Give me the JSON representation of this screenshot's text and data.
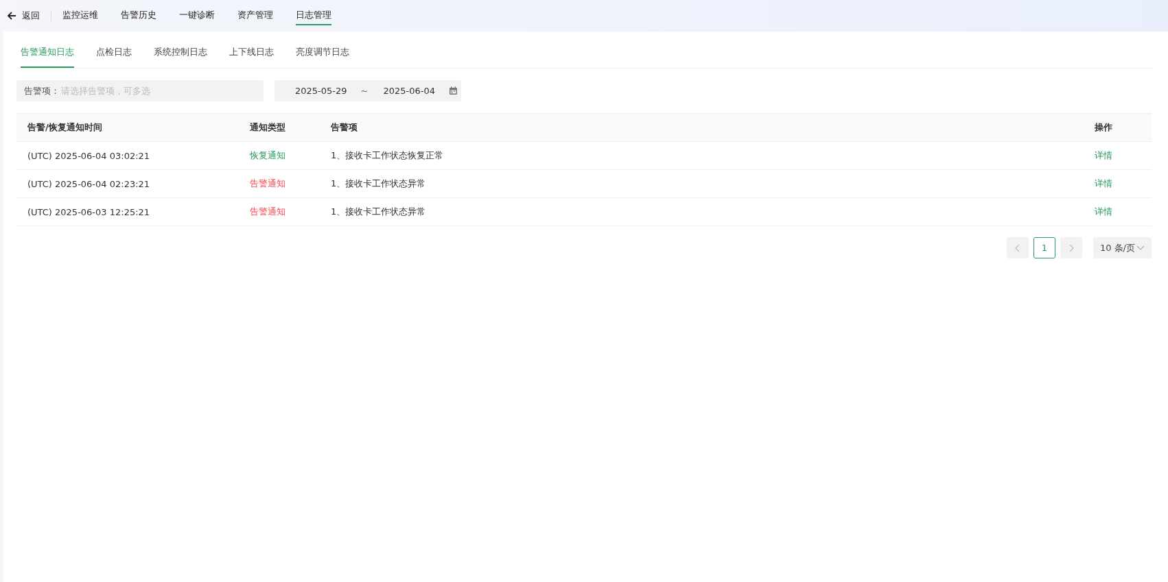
{
  "top_nav": {
    "back": "返回",
    "items": [
      {
        "label": "监控运维",
        "selected": false
      },
      {
        "label": "告警历史",
        "selected": false
      },
      {
        "label": "一键诊断",
        "selected": false
      },
      {
        "label": "资产管理",
        "selected": false
      },
      {
        "label": "日志管理",
        "selected": true
      }
    ]
  },
  "tabs": [
    {
      "label": "告警通知日志",
      "selected": true
    },
    {
      "label": "点检日志",
      "selected": false
    },
    {
      "label": "系统控制日志",
      "selected": false
    },
    {
      "label": "上下线日志",
      "selected": false
    },
    {
      "label": "亮度调节日志",
      "selected": false
    }
  ],
  "filter": {
    "label": "告警项：",
    "placeholder": "请选择告警项，可多选",
    "date_start": "2025-05-29",
    "date_sep": "~",
    "date_end": "2025-06-04"
  },
  "table": {
    "columns": [
      "告警/恢复通知时间",
      "通知类型",
      "告警项",
      "操作"
    ],
    "rows": [
      {
        "time": "(UTC) 2025-06-04 03:02:21",
        "type": "恢复通知",
        "kind": "recovery",
        "item": "1、接收卡工作状态恢复正常",
        "action": "详情"
      },
      {
        "time": "(UTC) 2025-06-04 02:23:21",
        "type": "告警通知",
        "kind": "alarm",
        "item": "1、接收卡工作状态异常",
        "action": "详情"
      },
      {
        "time": "(UTC) 2025-06-03 12:25:21",
        "type": "告警通知",
        "kind": "alarm",
        "item": "1、接收卡工作状态异常",
        "action": "详情"
      }
    ]
  },
  "pagination": {
    "page": "1",
    "page_size": "10 条/页"
  }
}
